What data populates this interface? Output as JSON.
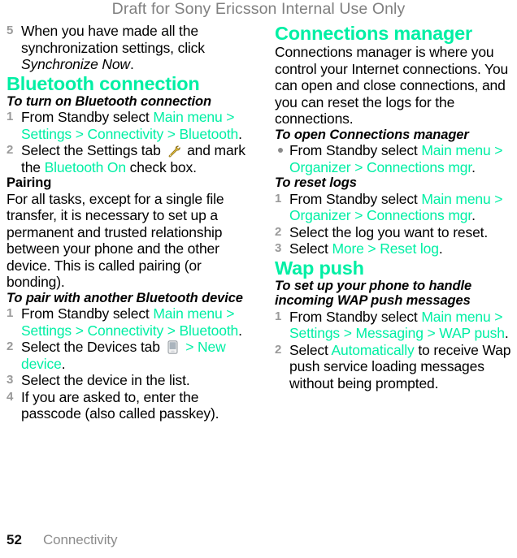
{
  "header": {
    "draft_notice": "Draft for Sony Ericsson Internal Use Only",
    "color": "#808080"
  },
  "theme": {
    "accent": "#00efa4",
    "text": "#000000",
    "muted": "#8c8c8c",
    "step_number": "#9a9a9a"
  },
  "left_column": {
    "continued_step": {
      "number": "5",
      "text_part1": "When you have made all the synchronization settings, click ",
      "text_italic": "Synchronize Now",
      "text_part2": "."
    },
    "section": {
      "title": "Bluetooth connection",
      "task1": {
        "title": "To turn on Bluetooth connection",
        "steps": [
          {
            "number": "1",
            "pre": "From Standby select ",
            "path": "Main menu > Settings > Connectivity > Bluetooth",
            "post": "."
          },
          {
            "number": "2",
            "pre": "Select the Settings tab ",
            "icon": "wrench-icon",
            "mid": " and mark the ",
            "path": "Bluetooth On",
            "post": " check box."
          }
        ]
      },
      "pairing": {
        "title": "Pairing",
        "body": "For all tasks, except for a single file transfer, it is necessary to set up a permanent and trusted relationship between your phone and the other device. This is called pairing (or bonding)."
      },
      "task2": {
        "title": "To pair with another Bluetooth device",
        "steps": [
          {
            "number": "1",
            "pre": "From Standby select ",
            "path": "Main menu > Settings > Connectivity > Bluetooth",
            "post": "."
          },
          {
            "number": "2",
            "pre": "Select the Devices tab ",
            "icon": "device-icon",
            "mid": " ",
            "path": "> New device",
            "post": "."
          },
          {
            "number": "3",
            "pre": "Select the device in the list.",
            "path": "",
            "post": ""
          },
          {
            "number": "4",
            "pre": "If you are asked to, enter the passcode (also called passkey).",
            "path": "",
            "post": ""
          }
        ]
      }
    }
  },
  "right_column": {
    "section1": {
      "title": "Connections manager",
      "body": "Connections manager is where you control your Internet connections. You can open and close connections, and you can reset the logs for the connections.",
      "task1": {
        "title": "To open Connections manager",
        "bullet_step": {
          "pre": "From Standby select ",
          "path": "Main menu > Organizer > Connections mgr",
          "post": "."
        }
      },
      "task2": {
        "title": "To reset logs",
        "steps": [
          {
            "number": "1",
            "pre": "From Standby select ",
            "path": "Main menu > Organizer > Connections mgr",
            "post": "."
          },
          {
            "number": "2",
            "pre": "Select the log you want to reset.",
            "path": "",
            "post": ""
          },
          {
            "number": "3",
            "pre": "Select ",
            "path": "More > Reset log",
            "post": "."
          }
        ]
      }
    },
    "section2": {
      "title": "Wap push",
      "task1": {
        "title": "To set up your phone to handle incoming WAP push messages",
        "steps": [
          {
            "number": "1",
            "pre": "From Standby select ",
            "path": "Main menu > Settings > Messaging > WAP push",
            "post": "."
          },
          {
            "number": "2",
            "pre": "Select ",
            "path": "Automatically",
            "post": " to receive Wap push service loading messages without being prompted."
          }
        ]
      }
    }
  },
  "footer": {
    "page_number": "52",
    "chapter": "Connectivity"
  }
}
